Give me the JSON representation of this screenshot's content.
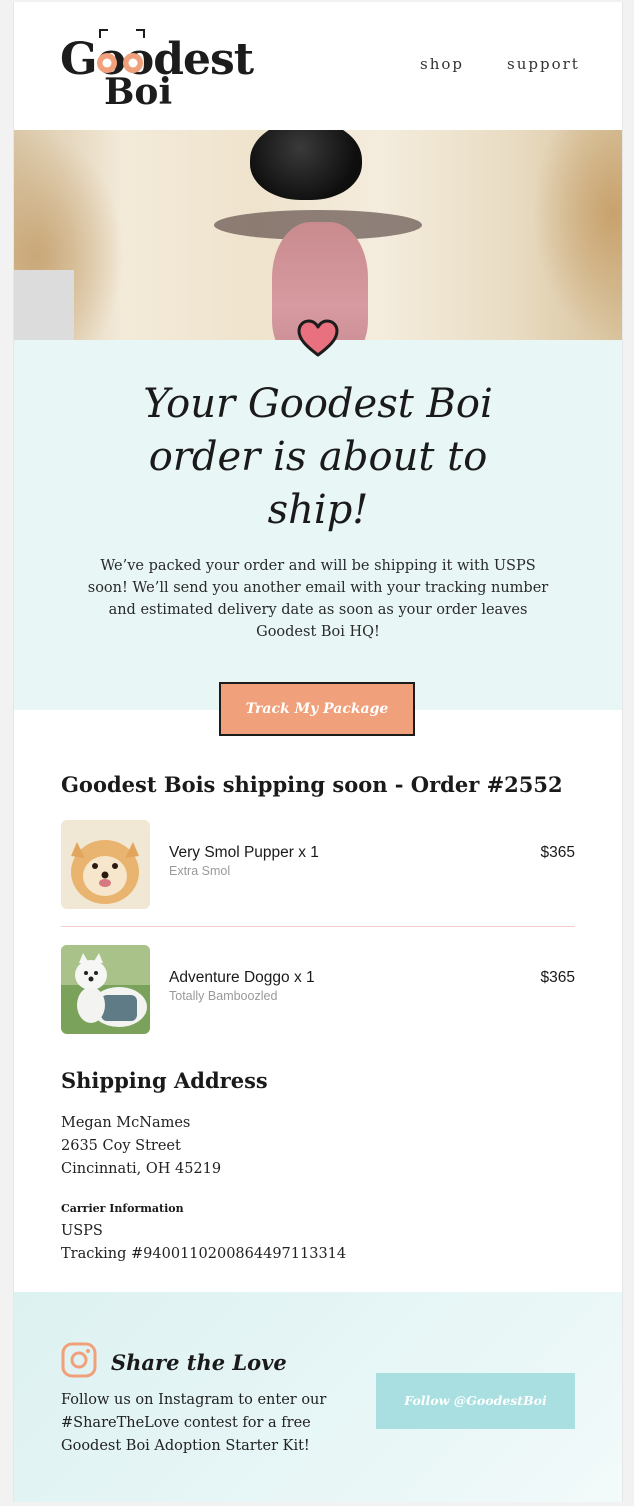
{
  "brand": {
    "logo_line1": "Goodest",
    "logo_line2": "Boi"
  },
  "nav": {
    "shop": "shop",
    "support": "support"
  },
  "hero": {
    "headline": "Your Goodest Boi order is about to ship!",
    "message": "We’ve packed your order and will be shipping it with USPS soon! We’ll send you another email with your tracking number and estimated delivery date as soon as your order leaves Goodest Boi HQ!"
  },
  "cta": {
    "track_label": "Track My Package"
  },
  "order": {
    "title": "Goodest Bois shipping soon - Order #2552",
    "items": [
      {
        "name": "Very Smol Pupper x 1",
        "variant": "Extra Smol",
        "price": "$365"
      },
      {
        "name": "Adventure Doggo x 1",
        "variant": "Totally Bamboozled",
        "price": "$365"
      }
    ]
  },
  "shipping": {
    "title": "Shipping Address",
    "name": "Megan McNames",
    "street": "2635 Coy Street",
    "city": "Cincinnati, OH 45219",
    "carrier_title": "Carrier Information",
    "carrier": "USPS",
    "tracking": "Tracking #9400110200864497113314"
  },
  "footer": {
    "share_title": "Share the Love",
    "share_text": "Follow us on Instagram to enter our #ShareTheLove contest for a free Goodest Boi Adoption Starter Kit!",
    "follow_label": "Follow @GoodestBoi"
  },
  "colors": {
    "accent_orange": "#f0a07a",
    "mint_bg": "#e8f6f6",
    "heart_pink": "#e8707f",
    "follow_teal": "#a9dfe0"
  }
}
